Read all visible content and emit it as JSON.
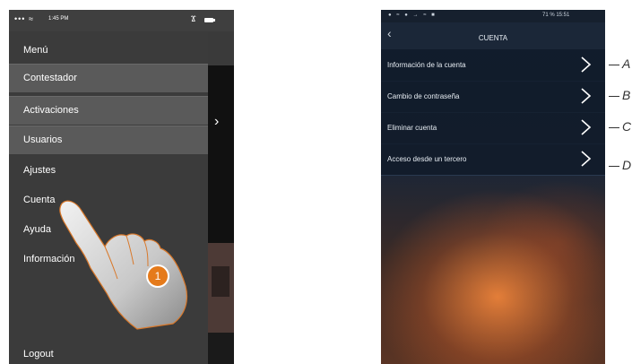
{
  "left_screen": {
    "status": {
      "signal": "••• ",
      "time": "1:45 PM"
    },
    "menu_title": "Menú",
    "items": [
      {
        "label": "Contestador"
      },
      {
        "label": "Activaciones"
      },
      {
        "label": "Usuarios"
      },
      {
        "label": "Ajustes"
      },
      {
        "label": "Cuenta"
      },
      {
        "label": "Ayuda"
      },
      {
        "label": "Información"
      }
    ],
    "logout": "Logout",
    "step_badge": "1"
  },
  "right_screen": {
    "status_right": "71 % 15:51",
    "title": "CUENTA",
    "rows": [
      {
        "label": "Información de la cuenta",
        "callout": "A"
      },
      {
        "label": "Cambio de contraseña",
        "callout": "B"
      },
      {
        "label": "Eliminar cuenta",
        "callout": "C"
      },
      {
        "label": "Acceso desde un tercero",
        "callout": "D"
      }
    ]
  },
  "colors": {
    "badge": "#e57a1a",
    "menu_bg": "#3b3b3b",
    "highlight": "#5a5a5a"
  },
  "icons": [
    "wifi-icon",
    "bluetooth-icon",
    "battery-icon",
    "chevron-right-icon",
    "back-icon",
    "hand-pointer-icon"
  ]
}
